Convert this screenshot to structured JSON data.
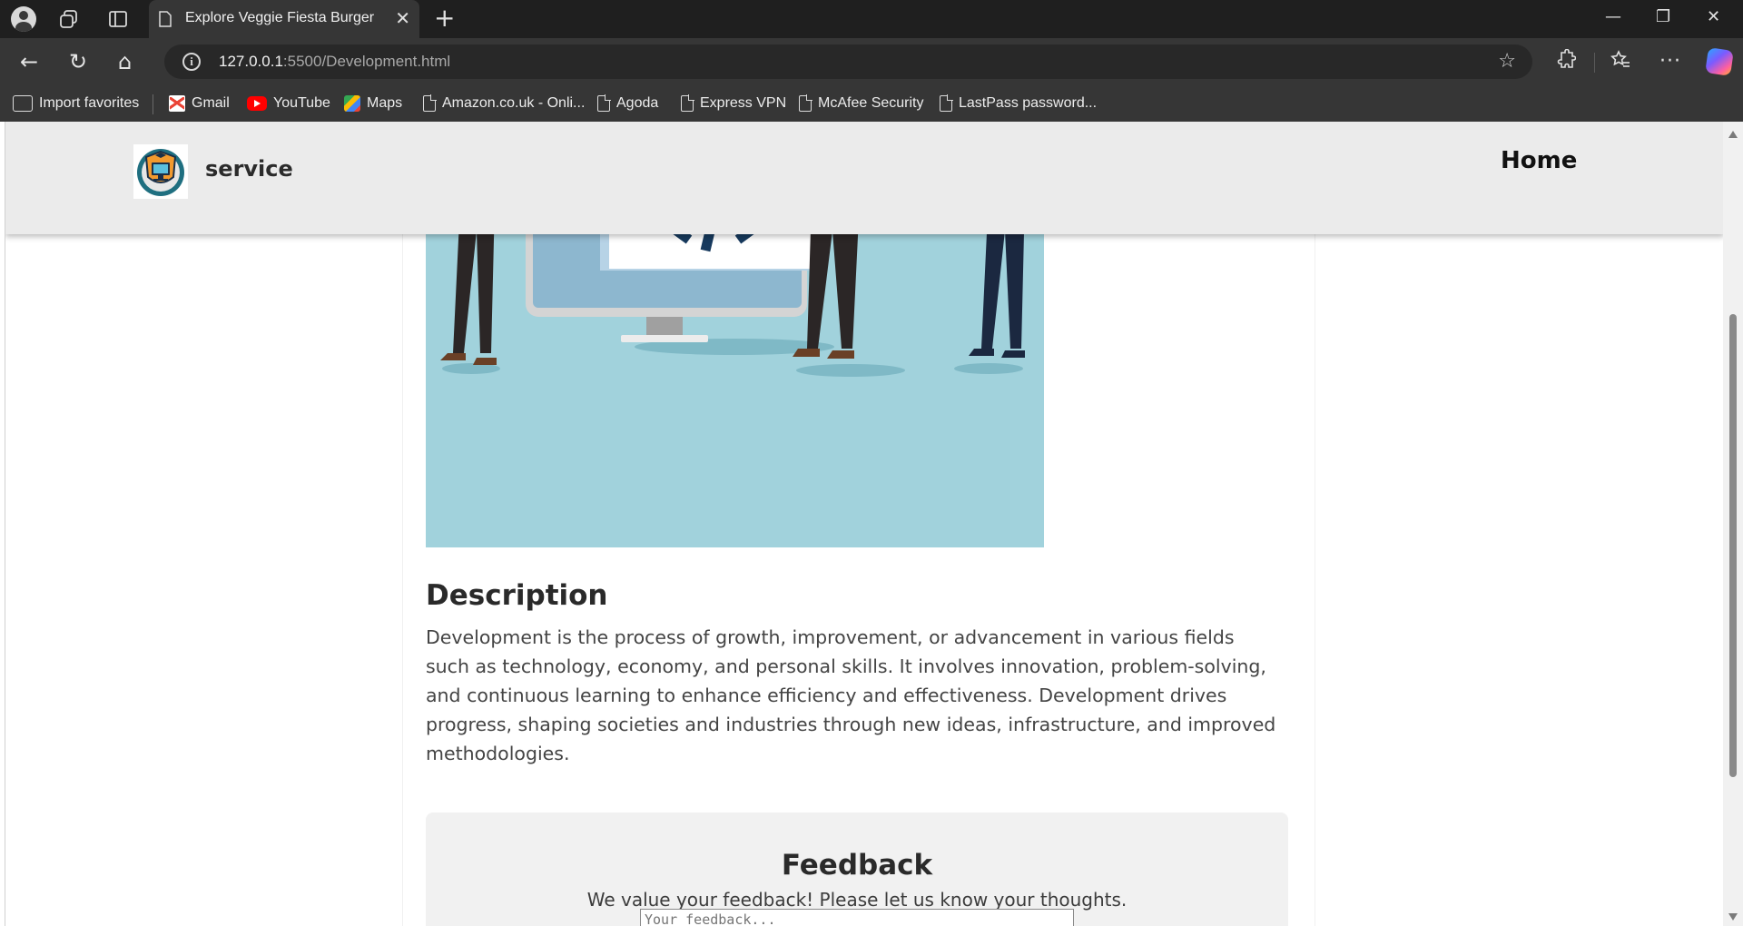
{
  "browser": {
    "tab_title": "Explore Veggie Fiesta Burger",
    "url_host": "127.0.0.1",
    "url_path": ":5500/Development.html",
    "bookmarks": [
      {
        "label": "Import favorites",
        "icon": "folder-icon"
      },
      {
        "label": "Gmail",
        "icon": "gmail-icon"
      },
      {
        "label": "YouTube",
        "icon": "youtube-icon"
      },
      {
        "label": "Maps",
        "icon": "maps-icon"
      },
      {
        "label": "Amazon.co.uk - Onli...",
        "icon": "page-icon"
      },
      {
        "label": "Agoda",
        "icon": "page-icon"
      },
      {
        "label": "Express VPN",
        "icon": "page-icon"
      },
      {
        "label": "McAfee Security",
        "icon": "page-icon"
      },
      {
        "label": "LastPass password...",
        "icon": "page-icon"
      }
    ]
  },
  "site": {
    "brand": "service",
    "nav_home": "Home"
  },
  "content": {
    "description_title": "Description",
    "description_text": "Development is the process of growth, improvement, or advancement in various fields such as technology, economy, and personal skills. It involves innovation, problem-solving, and continuous learning to enhance efficiency and effectiveness. Development drives progress, shaping societies and industries through new ideas, infrastructure, and improved methodologies."
  },
  "feedback": {
    "title": "Feedback",
    "subtitle": "We value your feedback! Please let us know your thoughts.",
    "placeholder": "Your feedback..."
  },
  "colors": {
    "hero_bg": "#a1d2dc",
    "header_bg": "#ebebeb",
    "code_navy": "#173a5e"
  }
}
